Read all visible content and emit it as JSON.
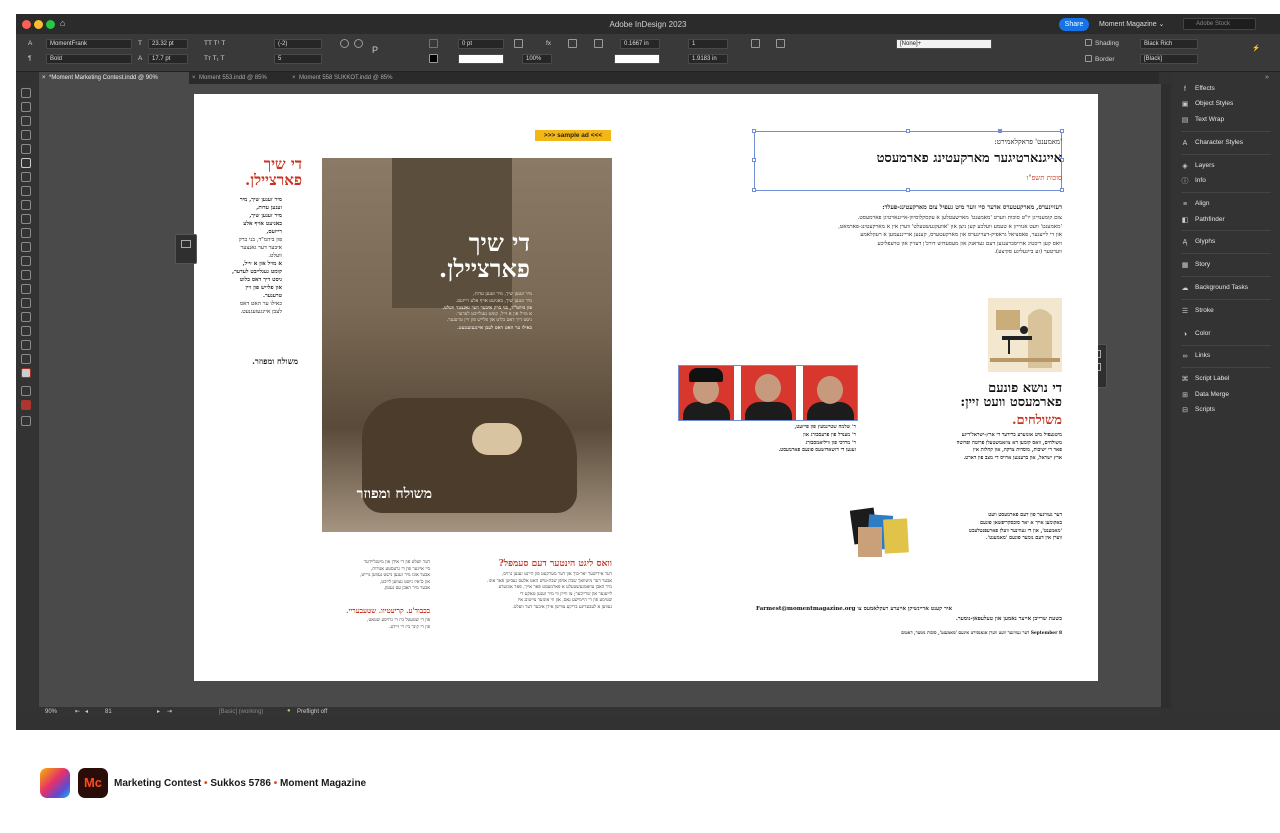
{
  "window": {
    "title": "Adobe InDesign 2023",
    "share_label": "Share",
    "workspace": "Moment Magazine",
    "stock_placeholder": "Adobe Stock"
  },
  "control": {
    "font_family": "MomentFrank",
    "font_style": "Bold",
    "font_size": "23.32 pt",
    "leading": "17.7 pt",
    "tracking": "(-2)",
    "kerning": "5",
    "stroke_weight": "0 pt",
    "scale": "100%",
    "ref_value_1": "0.1667 in",
    "ref_value_2": "1",
    "ref_value_3": "1.9183 in",
    "paragraph_style": "[None]+",
    "shading_label": "Shading",
    "border_label": "Border",
    "shading_swatch": "Black Rich",
    "border_swatch": "[Black]"
  },
  "tabs": [
    {
      "label": "*Moment Marketing Contest.indd @ 90%"
    },
    {
      "label": "Moment 553.indd @ 85%"
    },
    {
      "label": "Moment 558 SUKKOT.indd @ 85%"
    }
  ],
  "status": {
    "zoom": "90%",
    "page": "81",
    "style": "[Basic] (working)",
    "preflight": "Preflight off"
  },
  "panels": [
    {
      "label": "Effects",
      "icon": "fx-icon"
    },
    {
      "label": "Object Styles",
      "icon": "object-styles-icon"
    },
    {
      "label": "Text Wrap",
      "icon": "text-wrap-icon"
    },
    {
      "label": "Character Styles",
      "icon": "character-styles-icon"
    },
    {
      "label": "Layers",
      "icon": "layers-icon"
    },
    {
      "label": "Info",
      "icon": "info-icon"
    },
    {
      "label": "Align",
      "icon": "align-icon"
    },
    {
      "label": "Pathfinder",
      "icon": "pathfinder-icon"
    },
    {
      "label": "Glyphs",
      "icon": "glyphs-icon"
    },
    {
      "label": "Story",
      "icon": "story-icon"
    },
    {
      "label": "Background Tasks",
      "icon": "background-tasks-icon"
    },
    {
      "label": "Stroke",
      "icon": "stroke-icon"
    },
    {
      "label": "Color",
      "icon": "color-icon"
    },
    {
      "label": "Links",
      "icon": "links-icon"
    },
    {
      "label": "Script Label",
      "icon": "script-label-icon"
    },
    {
      "label": "Data Merge",
      "icon": "data-merge-icon"
    },
    {
      "label": "Scripts",
      "icon": "scripts-icon"
    }
  ],
  "left_page": {
    "sample_ad": ">>> sample ad <<<",
    "heading": "די שיך פארציילן.",
    "col1_lines": [
      "מיר זענען שיך, מיר",
      "זענען עדות,",
      "מיר זענען שיך,",
      "באגיעט אויף אלע",
      "רייזעס,",
      "פון ביהמ\"ד, בני ברק",
      "איבער דער גאנצער",
      "וועלט.",
      "א מויל און א זייל,",
      "קומט געגלייבט לעדער,",
      "גיסט דיך דאס בלוט",
      "און פלייש פון זיין",
      "טרעגער.",
      "כאילו ער האט דאס",
      "לעבן איינגעזעגנעט."
    ],
    "col1_tag": "משולח ומפוזר.",
    "photo_title": "די שיך פארציילן.",
    "photo_sub": [
      "מיר זענען שיך, מיר זענען עדות,",
      "מיר זענען שיך, באגיעט אויף אלע רייזעס.",
      "פון ביהמ\"ד, בני ברק איבער דער גאנצער וועלט.",
      "א מויל און א זייל, קומט געגלייבט לעדער.",
      "גיסט דיך דאס בלוט און פלייש פון זיין טרעגער.",
      "כאילו ער האט דאס לעבן איינגעזעגנעט."
    ],
    "photo_logo": "משולח ומפוזר",
    "section_heading": "וואס ליגט הינטער דעם סעמפל?",
    "section_text": [
      "דער אידישער יאר-בוך און דער מערקעט פון היינט זענען גרויס,",
      "אבער דער מיטוואך שבת אויפן שבת-טיש האט אלעס געביטן פאר אונז.",
      "מיר האבן צוזאמגעשטעלט א פארמעסט פאר אייך, פאר אונזערע",
      "לייענער און שרייבער; צו ווייזן ווי מיר זענען טאקע די",
      "שטימע פון די היימישע גאס, און ווי אונזער צייטונג איז",
      "געווען א לעבעדיגע בריקע צווישן אידן איבער דער וועלט."
    ],
    "col3_text": [
      "דער וועלט פון די אידן און מיטגליידער",
      "ביי איינער פון די גרעסטע אגודות,",
      "אבער אונז מיר זענען נישט געווען גרייט,",
      "און ס'איז נישט געווען לייכט,",
      "אבער מיר האבן עס געטון."
    ],
    "col3_tag": "בכבוד'ע. קריעטיוו. שטעבעריי.",
    "col3_text2": [
      "פון די שטעטל ביז די גרויסע שטאט,",
      "פון די קינד ביז די זיידע."
    ]
  },
  "right_page": {
    "kicker": "'מאמענט' פראקלאמירט:",
    "headline": "אייגנארטיגער מארקעטינג פארמעסט",
    "dateline": "סוכות תשפ\"ו",
    "intro_bold": "דעזיינערס, מארקעטערס אדער סיי ווער מיט געפיל צום מארקעטינג-פעלד:",
    "intro_lines": [
      "צום קומענדיגן יו\"ט סוכות ווערט 'מאמענט' מארשעטלען א עקסקלוסיוון-אייגנארטיגן פארמעסט.",
      "'מאמענט' וועט אנווייזן א טעמע וועלכע קען ניצן און 'אוועקגעשטעלט' ווערן אין א מארקעטינג-פארמאט,",
      "און די לייענער, פאסציאל גראפיק-דעזיינערס און מארקעטערס, קענען ארייננעמען א רעקלאמע",
      "וואס קען ריכטיג ארויסברענגען דעם געדאנק און מעסעדזש דורכ'ן דעזיין און טרעפליכע",
      "ווערטער (זע ביינעליגע סקיצע)."
    ],
    "topic_heading": [
      "די נושא פונעם",
      "פארמעסט וועט זיין:"
    ],
    "topic_red": "משולחים.",
    "topic_text": [
      "מיטגעפיל מיט אונזערע ברידער די ארץ-ישראל'דיגע",
      "משולחים, וואס קומען דא צוזאמשטעלן פרוטה ופרוטה",
      "פאר די ישיבות, מוסדות צדקה, און קהלות אין",
      "ארץ ישראל, און ברענגען ארויס די מצב פון דארט."
    ],
    "judges_text": [
      "ר' שלמה שטיינמעץ פון פייזעט,",
      "ר' מענדל פון פרעסבורג און",
      "ר' מרדכי פון וויליאמסבורג",
      "זענען די דזשאדזשעס פונעם פארמעסט."
    ],
    "prize_text": [
      "דער געווינער פון דעם פארמעסט וועט",
      "באקומען אייך א יאר סובסקריפשאן פונעם",
      "'מאמענט', און די געווינער וועלן פארעפנטלעכט",
      "ווערן אין דעם נומער פונעם 'מאמענט'."
    ],
    "contact_line": "Farmest@momentmagazine.org",
    "contact_lead": "איר קענט אריינשיקן אייערע רעקלאמעס צו",
    "contact_line2": "בשעת שרייבן אייער נאמען און טעלעפאן-נומער.",
    "footer_note": "8 September דער געווינער וועט ווערן אנאנסירט אינעם 'מאמענט', סוכות נומער, דאטום"
  },
  "footer_caption": {
    "app_initials": "Mc",
    "part1": "Marketing Contest",
    "part2": "Sukkos 5786",
    "part3": "Moment Magazine",
    "bullet": "•"
  },
  "colors": {
    "accent": "#1473e6",
    "heading_red": "#c8321f",
    "sample_ad_bg": "#f3b617",
    "portrait_bg": "#d8372d"
  }
}
